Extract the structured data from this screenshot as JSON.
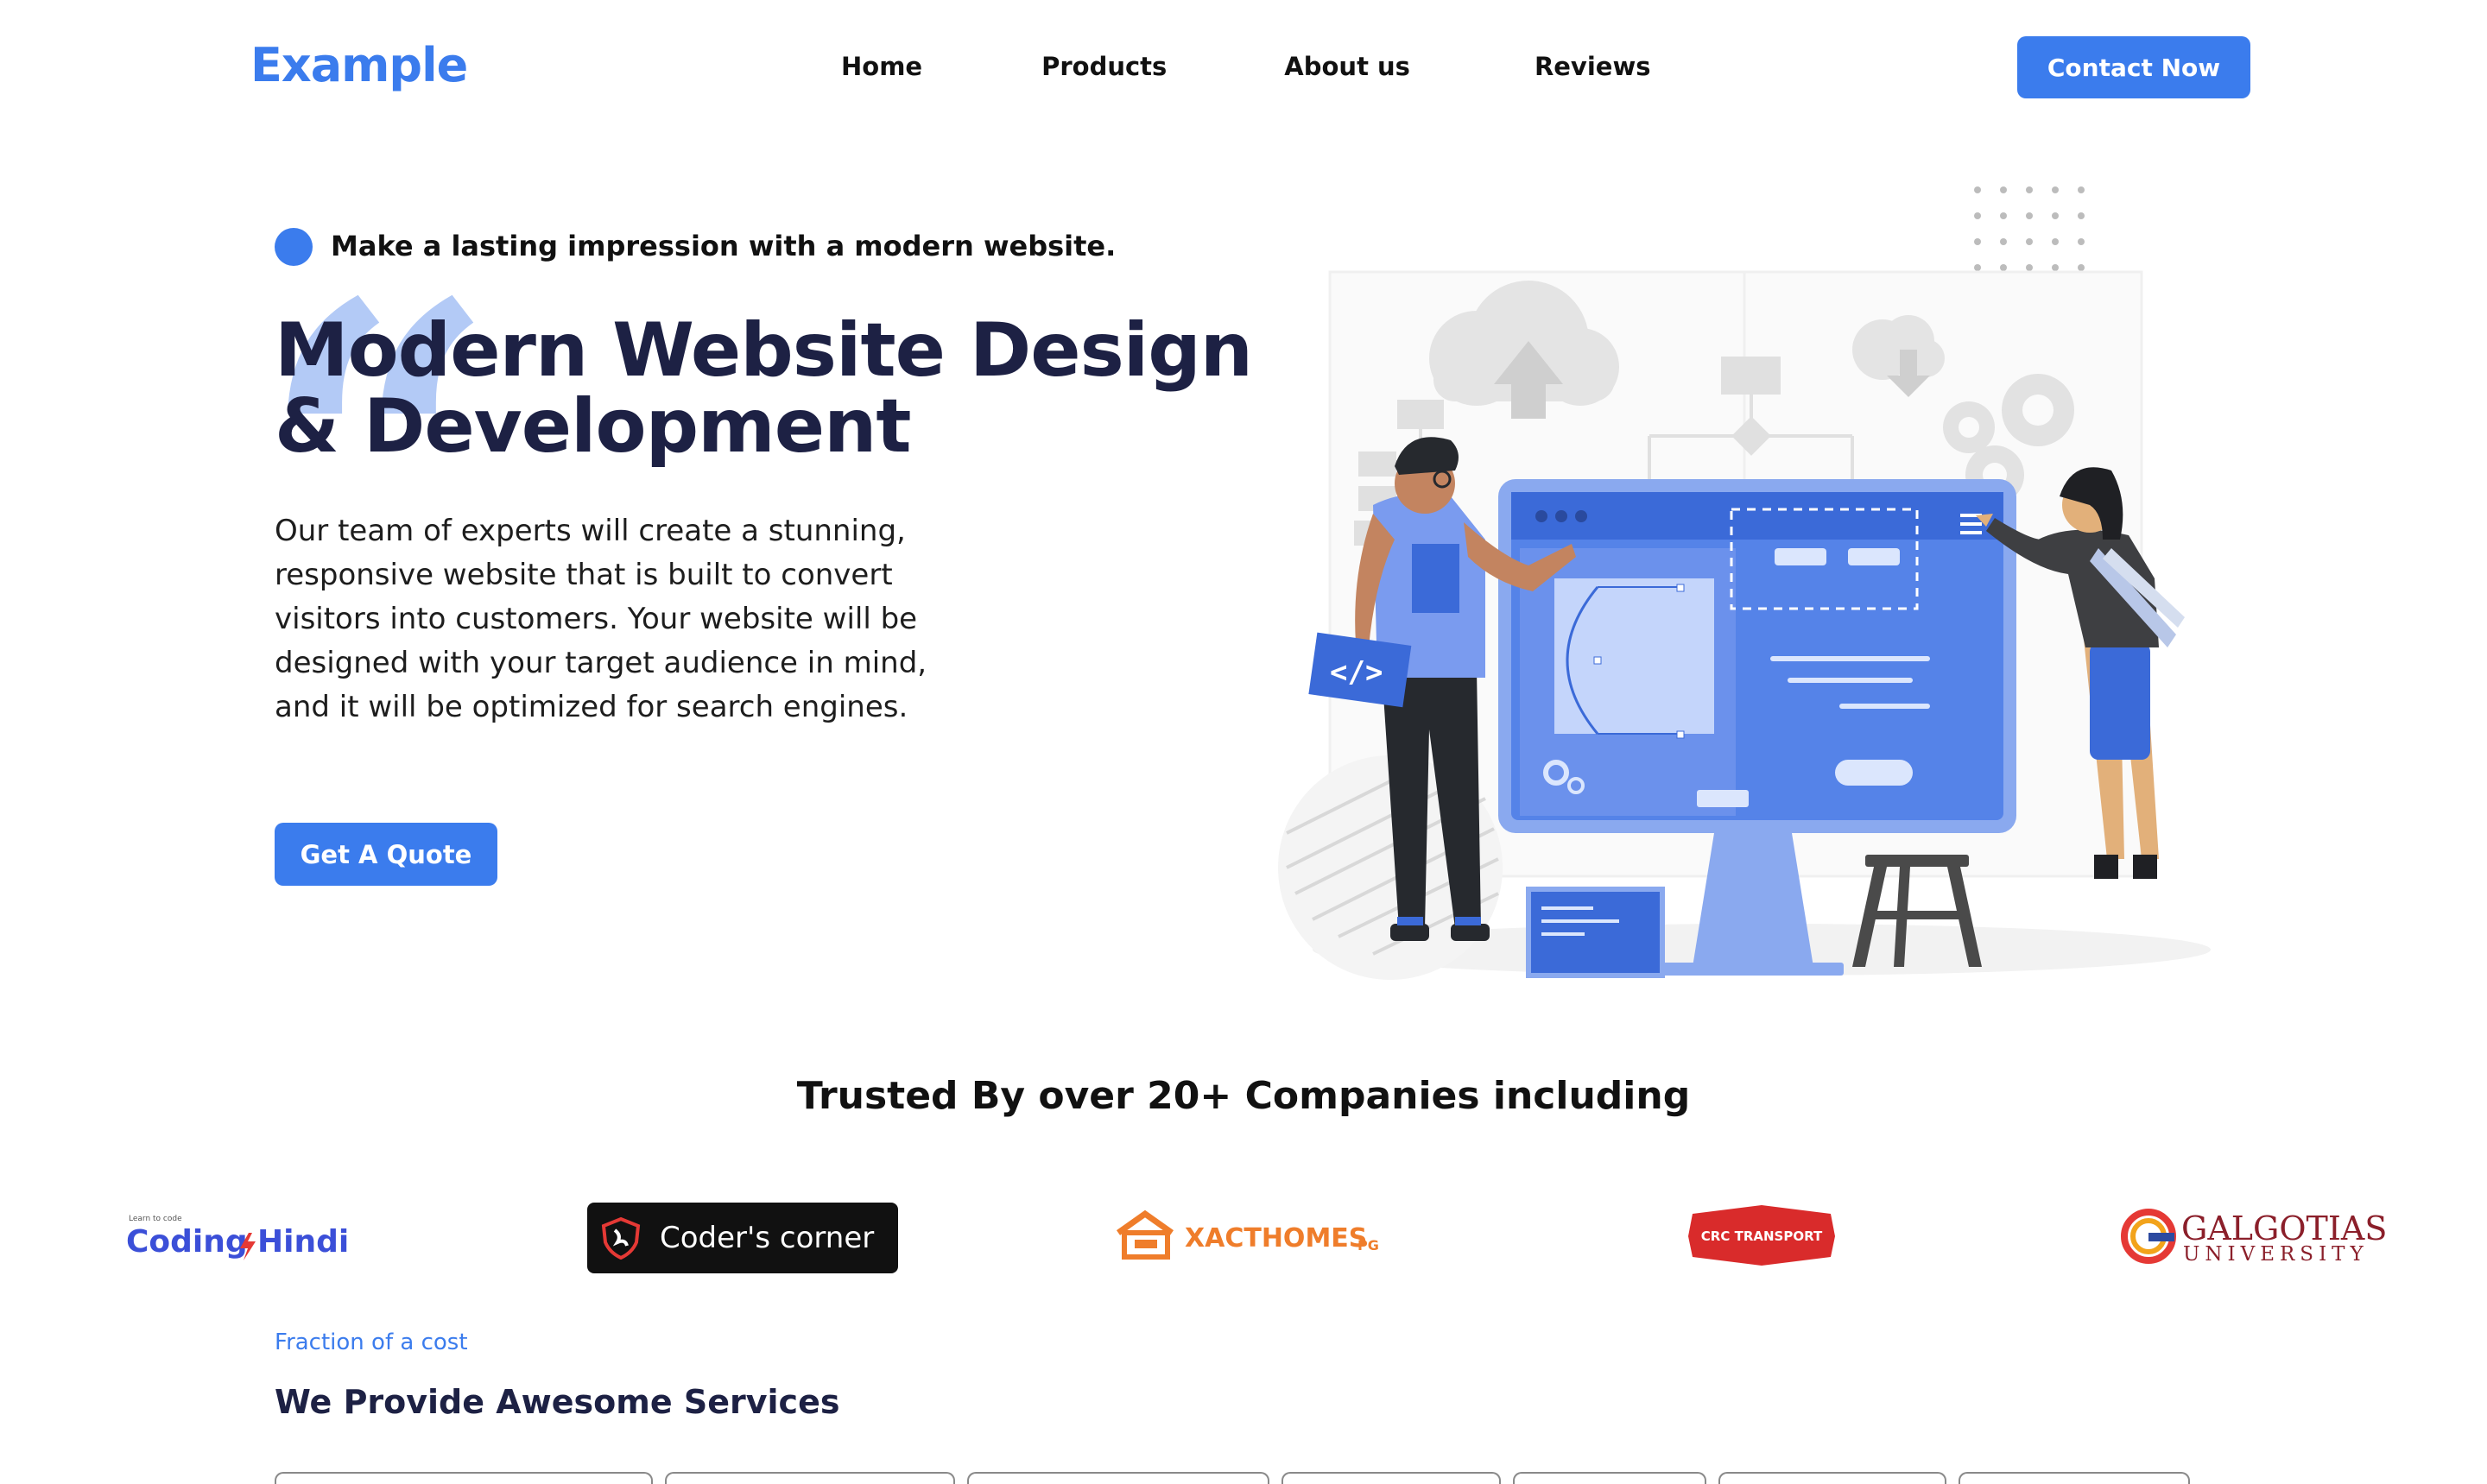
{
  "nav": {
    "logo": "Example",
    "links": [
      "Home",
      "Products",
      "About us",
      "Reviews"
    ],
    "contact_label": "Contact Now"
  },
  "hero": {
    "tagline": "Make a lasting impression with a modern website.",
    "title_line1": "Modern Website Design",
    "title_line2": "& Development",
    "description": "Our team of experts will create a stunning, responsive website that is built to convert visitors into customers. Your website will be designed with your target audience in mind, and it will be optimized for search engines.",
    "quote_button": "Get A Quote"
  },
  "trusted": {
    "heading": "Trusted By over 20+ Companies including",
    "logos": [
      {
        "name": "Coding Hindi",
        "small": "Learn to code"
      },
      {
        "name": "Coder's corner"
      },
      {
        "name": "XACTHOMES",
        "suffix": "PG"
      },
      {
        "name": "CRC TRANSPORT"
      },
      {
        "name": "GALGOTIAS",
        "sub": "UNIVERSITY"
      }
    ]
  },
  "services": {
    "eyebrow": "Fraction of a cost",
    "title": "We Provide Awesome Services"
  },
  "colors": {
    "accent": "#3b7ced",
    "heading": "#1d2144",
    "quote_mark": "#b3caf6"
  }
}
